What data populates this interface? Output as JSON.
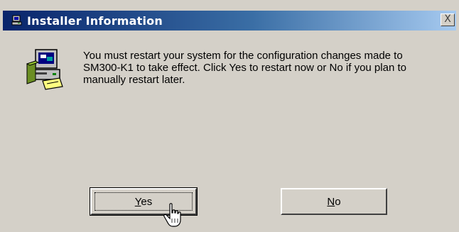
{
  "dialog": {
    "title": "Installer Information",
    "close_symbol": "X",
    "message": "You must restart your system for the configuration changes made to SM300-K1 to take effect. Click Yes to restart now or No if you plan to manually restart later.",
    "icon": "installer-computer-icon"
  },
  "buttons": {
    "yes_first": "Y",
    "yes_rest": "es",
    "no_first": "N",
    "no_rest": "o"
  },
  "cursor": "hand-pointer-icon",
  "colors": {
    "titlebar_start": "#08246b",
    "titlebar_end": "#a6caf0",
    "face": "#d4d0c8"
  }
}
